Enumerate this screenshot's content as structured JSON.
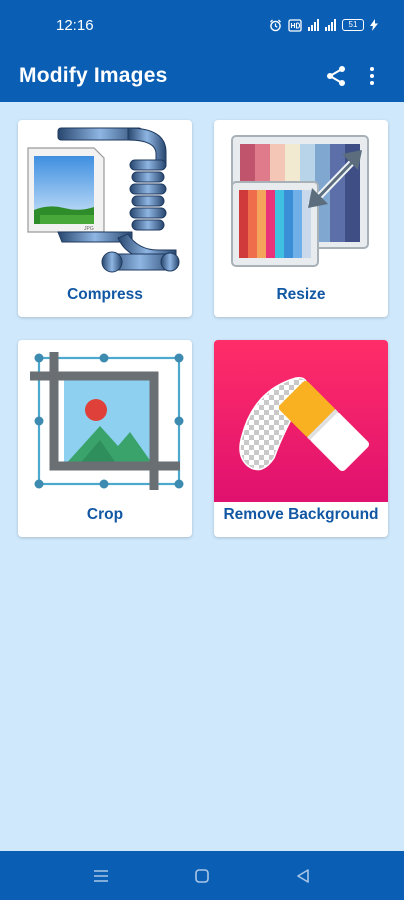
{
  "status_bar": {
    "time": "12:16",
    "battery": "51",
    "icons": [
      "alarm-icon",
      "hd-voice-icon",
      "cell-signal-icon",
      "cell-signal-icon",
      "battery-icon",
      "charging-icon"
    ]
  },
  "app_bar": {
    "title": "Modify Images",
    "actions": [
      "share-icon",
      "more-vert-icon"
    ]
  },
  "tools": [
    {
      "label": "Compress",
      "icon": "compress-icon"
    },
    {
      "label": "Resize",
      "icon": "resize-icon"
    },
    {
      "label": "Crop",
      "icon": "crop-icon"
    },
    {
      "label": "Remove Background",
      "icon": "eraser-icon"
    }
  ],
  "nav_bar": {
    "buttons": [
      "recents-icon",
      "home-icon",
      "back-icon"
    ]
  },
  "colors": {
    "primary": "#0a5fb4",
    "background": "#cfe8fb",
    "label": "#1257a3",
    "remove_bg_accent": "#e8135f"
  }
}
